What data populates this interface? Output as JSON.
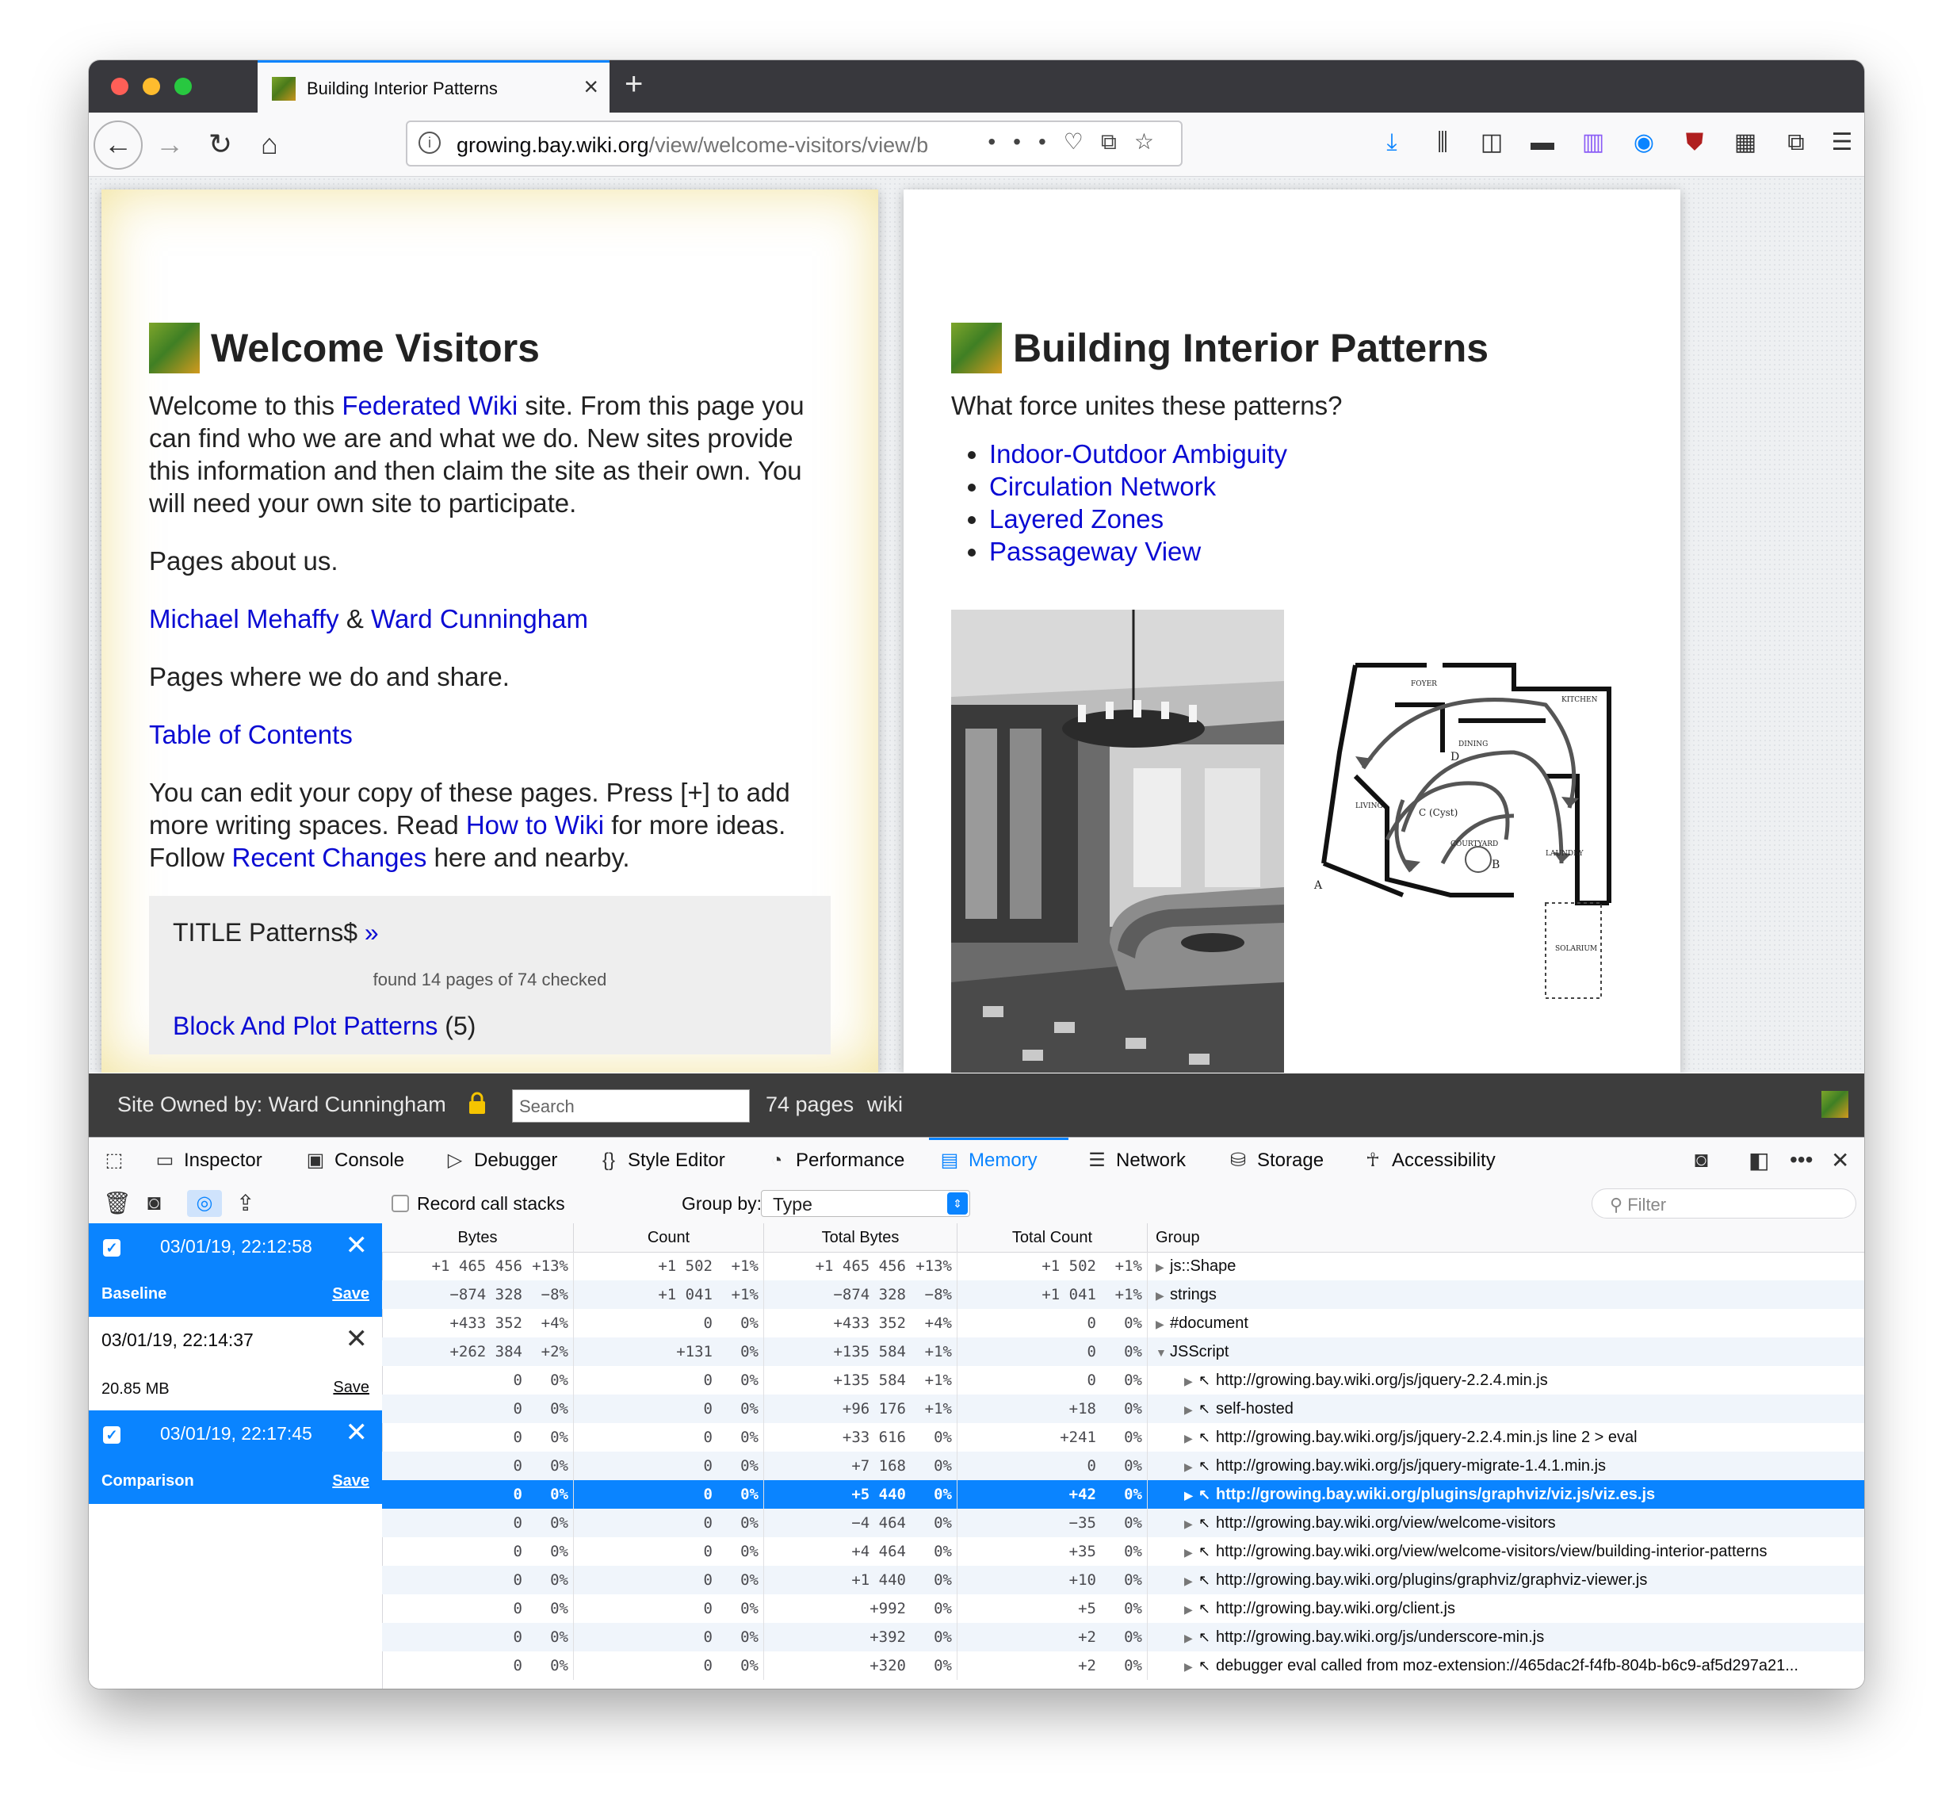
{
  "browser": {
    "tab_title": "Building Interior Patterns",
    "url_host": "growing.bay.wiki.org",
    "url_prefix": "",
    "url_path": "/view/welcome-visitors/view/b",
    "colors": {
      "accent": "#0a84ff",
      "titlebar": "#38383d"
    }
  },
  "left_page": {
    "title": "Welcome Visitors",
    "p1_a": "Welcome to this ",
    "p1_link": "Federated Wiki",
    "p1_b": " site. From this page you can find who we are and what we do. New sites provide this information and then claim the site as their own. You will need your own site to participate.",
    "p2": "Pages about us.",
    "link_michael": "Michael Mehaffy",
    "amp": " & ",
    "link_ward": "Ward Cunningham",
    "p3": "Pages where we do and share.",
    "link_toc": "Table of Contents",
    "p4_a": "You can edit your copy of these pages. Press [+] to add more writing spaces. Read ",
    "p4_link1": "How to Wiki",
    "p4_b": " for more ideas. Follow ",
    "p4_link2": "Recent Changes",
    "p4_c": " here and nearby.",
    "search_title": "TITLE Patterns$ ",
    "search_more": "»",
    "search_found": "found 14 pages of 74 checked",
    "cut_link": "Block And Plot Patterns",
    "cut_count": " (5)"
  },
  "right_page": {
    "title": "Building Interior Patterns",
    "question": "What force unites these patterns?",
    "links": [
      "Indoor-Outdoor Ambiguity",
      "Circulation Network",
      "Layered Zones",
      "Passageway View"
    ],
    "plan_labels": {
      "foyer": "FOYER",
      "kitchen": "KITCHEN",
      "dining": "DINING",
      "living": "LIVING",
      "courtyard": "COURTYARD",
      "laundry": "LAUNDRY",
      "solarium": "SOLARIUM",
      "d": "D",
      "c": "C (Cyst)",
      "b": "B",
      "a": "A"
    }
  },
  "wiki_footer": {
    "owned": "Site Owned by: Ward Cunningham",
    "search_placeholder": "Search",
    "pages": "74 pages",
    "wiki": "wiki"
  },
  "devtools": {
    "tabs": [
      {
        "label": "Inspector",
        "icon": "inspector-icon"
      },
      {
        "label": "Console",
        "icon": "console-icon"
      },
      {
        "label": "Debugger",
        "icon": "debugger-icon"
      },
      {
        "label": "Style Editor",
        "icon": "style-editor-icon"
      },
      {
        "label": "Performance",
        "icon": "performance-icon"
      },
      {
        "label": "Memory",
        "icon": "memory-icon"
      },
      {
        "label": "Network",
        "icon": "network-icon"
      },
      {
        "label": "Storage",
        "icon": "storage-icon"
      },
      {
        "label": "Accessibility",
        "icon": "accessibility-icon"
      }
    ],
    "active_tab": "Memory",
    "record_call_stacks": "Record call stacks",
    "group_by_label": "Group by:",
    "group_by_value": "Type",
    "filter_placeholder": "Filter",
    "snapshots": [
      {
        "date": "03/01/19, 22:12:58",
        "label": "Baseline",
        "save": "Save",
        "selected": true
      },
      {
        "date": "03/01/19, 22:14:37",
        "label": "20.85 MB",
        "save": "Save",
        "selected": false
      },
      {
        "date": "03/01/19, 22:17:45",
        "label": "Comparison",
        "save": "Save",
        "selected": true
      }
    ],
    "columns": [
      "Bytes",
      "Count",
      "Total Bytes",
      "Total Count",
      "Group"
    ],
    "rows": [
      {
        "b": "+1 465 456",
        "bp": "+13%",
        "c": "+1 502",
        "cp": "+1%",
        "tb": "+1 465 456",
        "tbp": "+13%",
        "tc": "+1 502",
        "tcp": "+1%",
        "g": "js::Shape",
        "lvl": 0,
        "tw": "▶"
      },
      {
        "b": "−874 328",
        "bp": "−8%",
        "c": "+1 041",
        "cp": "+1%",
        "tb": "−874 328",
        "tbp": "−8%",
        "tc": "+1 041",
        "tcp": "+1%",
        "g": "strings",
        "lvl": 0,
        "tw": "▶"
      },
      {
        "b": "+433 352",
        "bp": "+4%",
        "c": "0",
        "cp": "0%",
        "tb": "+433 352",
        "tbp": "+4%",
        "tc": "0",
        "tcp": "0%",
        "g": "#document",
        "lvl": 0,
        "tw": "▶"
      },
      {
        "b": "+262 384",
        "bp": "+2%",
        "c": "+131",
        "cp": "0%",
        "tb": "+135 584",
        "tbp": "+1%",
        "tc": "0",
        "tcp": "0%",
        "g": "JSScript",
        "lvl": 0,
        "tw": "▼"
      },
      {
        "b": "0",
        "bp": "0%",
        "c": "0",
        "cp": "0%",
        "tb": "+135 584",
        "tbp": "+1%",
        "tc": "0",
        "tcp": "0%",
        "g": "http://growing.bay.wiki.org/js/jquery-2.2.4.min.js",
        "lvl": 1,
        "tw": "▶"
      },
      {
        "b": "0",
        "bp": "0%",
        "c": "0",
        "cp": "0%",
        "tb": "+96 176",
        "tbp": "+1%",
        "tc": "+18",
        "tcp": "0%",
        "g": "self-hosted",
        "lvl": 1,
        "tw": "▶"
      },
      {
        "b": "0",
        "bp": "0%",
        "c": "0",
        "cp": "0%",
        "tb": "+33 616",
        "tbp": "0%",
        "tc": "+241",
        "tcp": "0%",
        "g": "http://growing.bay.wiki.org/js/jquery-2.2.4.min.js line 2 > eval",
        "lvl": 1,
        "tw": "▶"
      },
      {
        "b": "0",
        "bp": "0%",
        "c": "0",
        "cp": "0%",
        "tb": "+7 168",
        "tbp": "0%",
        "tc": "0",
        "tcp": "0%",
        "g": "http://growing.bay.wiki.org/js/jquery-migrate-1.4.1.min.js",
        "lvl": 1,
        "tw": "▶"
      },
      {
        "b": "0",
        "bp": "0%",
        "c": "0",
        "cp": "0%",
        "tb": "+5 440",
        "tbp": "0%",
        "tc": "+42",
        "tcp": "0%",
        "g": "http://growing.bay.wiki.org/plugins/graphviz/viz.js/viz.es.js",
        "lvl": 1,
        "tw": "▶",
        "sel": true
      },
      {
        "b": "0",
        "bp": "0%",
        "c": "0",
        "cp": "0%",
        "tb": "−4 464",
        "tbp": "0%",
        "tc": "−35",
        "tcp": "0%",
        "g": "http://growing.bay.wiki.org/view/welcome-visitors",
        "lvl": 1,
        "tw": "▶"
      },
      {
        "b": "0",
        "bp": "0%",
        "c": "0",
        "cp": "0%",
        "tb": "+4 464",
        "tbp": "0%",
        "tc": "+35",
        "tcp": "0%",
        "g": "http://growing.bay.wiki.org/view/welcome-visitors/view/building-interior-patterns",
        "lvl": 1,
        "tw": "▶"
      },
      {
        "b": "0",
        "bp": "0%",
        "c": "0",
        "cp": "0%",
        "tb": "+1 440",
        "tbp": "0%",
        "tc": "+10",
        "tcp": "0%",
        "g": "http://growing.bay.wiki.org/plugins/graphviz/graphviz-viewer.js",
        "lvl": 1,
        "tw": "▶"
      },
      {
        "b": "0",
        "bp": "0%",
        "c": "0",
        "cp": "0%",
        "tb": "+992",
        "tbp": "0%",
        "tc": "+5",
        "tcp": "0%",
        "g": "http://growing.bay.wiki.org/client.js",
        "lvl": 1,
        "tw": "▶"
      },
      {
        "b": "0",
        "bp": "0%",
        "c": "0",
        "cp": "0%",
        "tb": "+392",
        "tbp": "0%",
        "tc": "+2",
        "tcp": "0%",
        "g": "http://growing.bay.wiki.org/js/underscore-min.js",
        "lvl": 1,
        "tw": "▶"
      },
      {
        "b": "0",
        "bp": "0%",
        "c": "0",
        "cp": "0%",
        "tb": "+320",
        "tbp": "0%",
        "tc": "+2",
        "tcp": "0%",
        "g": "debugger eval called from moz-extension://465dac2f-f4fb-804b-b6c9-af5d297a21...",
        "lvl": 1,
        "tw": "▶"
      }
    ]
  }
}
